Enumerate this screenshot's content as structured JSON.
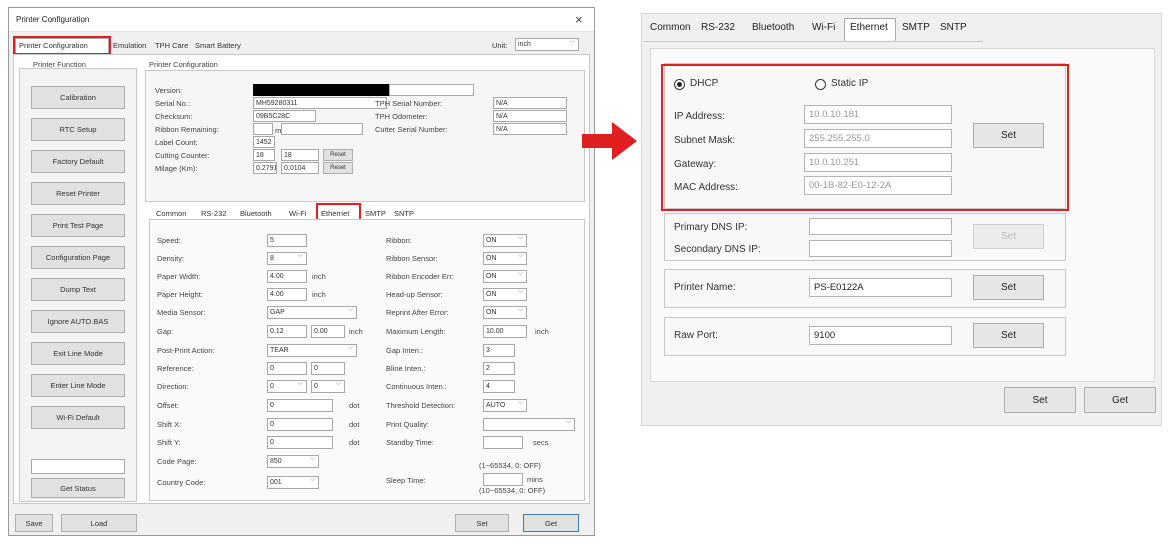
{
  "window": {
    "title": "Printer Configuration",
    "close": "×"
  },
  "main_tabs": [
    "Printer Configuration",
    "Emulation",
    "TPH Care",
    "Smart Battery"
  ],
  "unit": {
    "label": "Unit:",
    "value": "inch"
  },
  "function_group": {
    "title": "Printer Function",
    "buttons": [
      "Calibration",
      "RTC Setup",
      "Factory Default",
      "Reset Printer",
      "Print Test Page",
      "Configuration Page",
      "Dump Text",
      "Ignore AUTO.BAS",
      "Exit Line Mode",
      "Enter Line Mode",
      "Wi-Fi Default"
    ],
    "status_button": "Get Status"
  },
  "config_group": {
    "title": "Printer Configuration",
    "version_label": "Version:",
    "serial_label": "Serial No.:",
    "serial_value": "MH59280311",
    "checksum_label": "Checksum:",
    "checksum_value": "09B5C28C",
    "ribbon_remaining_label": "Ribbon Remaining:",
    "ribbon_unit": "m",
    "label_count_label": "Label Count:",
    "label_count_value": "1452",
    "cutting_label": "Cutting Counter:",
    "cutting_v1": "18",
    "cutting_v2": "18",
    "mileage_label": "Milage (Km):",
    "mileage_v1": "0.2791",
    "mileage_v2": "0.0104",
    "reset": "Reset",
    "tph_serial_label": "TPH Serial Number:",
    "tph_serial_value": "N/A",
    "tph_odometer_label": "TPH Odometer:",
    "tph_odometer_value": "N/A",
    "cutter_serial_label": "Cutter Serial Number:",
    "cutter_serial_value": "N/A"
  },
  "inner_tabs": [
    "Common",
    "RS-232",
    "Bluetooth",
    "Wi-Fi",
    "Ethernet",
    "SMTP",
    "SNTP"
  ],
  "common": {
    "left": [
      {
        "label": "Speed:",
        "value": "5"
      },
      {
        "label": "Density:",
        "value": "8"
      },
      {
        "label": "Paper Width:",
        "value": "4.00",
        "unit": "inch"
      },
      {
        "label": "Paper Height:",
        "value": "4.00",
        "unit": "inch"
      },
      {
        "label": "Media Sensor:",
        "value": "GAP"
      },
      {
        "label": "Gap:",
        "value": "0.12",
        "value2": "0.00",
        "unit": "inch"
      },
      {
        "label": "Post-Print Action:",
        "value": "TEAR"
      },
      {
        "label": "Reference:",
        "value": "0",
        "value2": "0"
      },
      {
        "label": "Direction:",
        "value": "0",
        "value2": "0"
      },
      {
        "label": "Offset:",
        "value": "0",
        "unit": "dot"
      },
      {
        "label": "Shift X:",
        "value": "0",
        "unit": "dot"
      },
      {
        "label": "Shift Y:",
        "value": "0",
        "unit": "dot"
      },
      {
        "label": "Code Page:",
        "value": "850"
      },
      {
        "label": "Country Code:",
        "value": "001"
      }
    ],
    "right": [
      {
        "label": "Ribbon:",
        "value": "ON"
      },
      {
        "label": "Ribbon Sensor:",
        "value": "ON"
      },
      {
        "label": "Ribbon Encoder Err:",
        "value": "ON"
      },
      {
        "label": "Head-up Sensor:",
        "value": "ON"
      },
      {
        "label": "Reprint After Error:",
        "value": "ON"
      },
      {
        "label": "Maximum Length:",
        "value": "10.00",
        "unit": "inch"
      },
      {
        "label": "Gap Inten.:",
        "value": "3"
      },
      {
        "label": "Bline Inten.:",
        "value": "2"
      },
      {
        "label": "Continuous Inten.:",
        "value": "4"
      },
      {
        "label": "Threshold Detection:",
        "value": "AUTO"
      },
      {
        "label": "Print Quality:",
        "value": ""
      },
      {
        "label": "Standby Time:",
        "value": "",
        "unit": "secs"
      }
    ],
    "standby_range": "(1~65534, 0: OFF)",
    "sleep_label": "Sleep Time:",
    "sleep_unit": "mins",
    "sleep_range": "(10~65534, 0: OFF)"
  },
  "bottom": {
    "save": "Save",
    "load": "Load",
    "set": "Set",
    "get": "Get"
  },
  "ethernet": {
    "tabs": [
      "Common",
      "RS-232",
      "Bluetooth",
      "Wi-Fi",
      "Ethernet",
      "SMTP",
      "SNTP"
    ],
    "dhcp": "DHCP",
    "static_ip": "Static IP",
    "ip_label": "IP Address:",
    "ip_value": "10.0.10.181",
    "mask_label": "Subnet Mask:",
    "mask_value": "255.255.255.0",
    "gateway_label": "Gateway:",
    "gateway_value": "10.0.10.251",
    "mac_label": "MAC Address:",
    "mac_value": "00-1B-82-E0-12-2A",
    "set": "Set",
    "dns1_label": "Primary DNS IP:",
    "dns2_label": "Secondary DNS IP:",
    "printer_name_label": "Printer Name:",
    "printer_name_value": "PS-E0122A",
    "raw_port_label": "Raw Port:",
    "raw_port_value": "9100",
    "get": "Get"
  },
  "colors": {
    "highlight": "#e02020",
    "accent": "#3c7fb1"
  }
}
